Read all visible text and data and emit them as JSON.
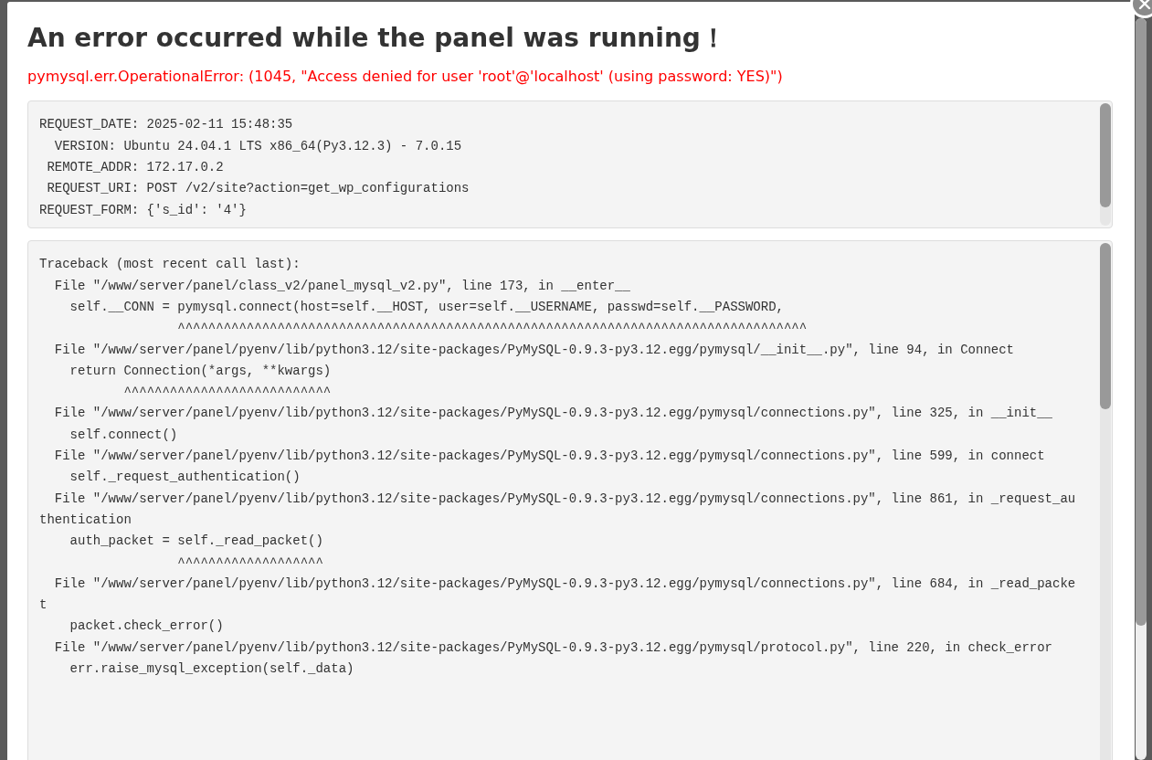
{
  "dialog": {
    "title": "An error occurred while the panel was running！",
    "error": "pymysql.err.OperationalError: (1045, \"Access denied for user 'root'@'localhost' (using password: YES)\")",
    "request_info": [
      "REQUEST_DATE: 2025-02-11 15:48:35",
      "  VERSION: Ubuntu 24.04.1 LTS x86_64(Py3.12.3) - 7.0.15",
      " REMOTE_ADDR: 172.17.0.2",
      " REQUEST_URI: POST /v2/site?action=get_wp_configurations",
      "REQUEST_FORM: {'s_id': '4'}"
    ],
    "traceback": [
      "Traceback (most recent call last):",
      "  File \"/www/server/panel/class_v2/panel_mysql_v2.py\", line 173, in __enter__",
      "    self.__CONN = pymysql.connect(host=self.__HOST, user=self.__USERNAME, passwd=self.__PASSWORD,",
      "                  ^^^^^^^^^^^^^^^^^^^^^^^^^^^^^^^^^^^^^^^^^^^^^^^^^^^^^^^^^^^^^^^^^^^^^^^^^^^^^^^^^^",
      "  File \"/www/server/panel/pyenv/lib/python3.12/site-packages/PyMySQL-0.9.3-py3.12.egg/pymysql/__init__.py\", line 94, in Connect",
      "    return Connection(*args, **kwargs)",
      "           ^^^^^^^^^^^^^^^^^^^^^^^^^^^",
      "  File \"/www/server/panel/pyenv/lib/python3.12/site-packages/PyMySQL-0.9.3-py3.12.egg/pymysql/connections.py\", line 325, in __init__",
      "    self.connect()",
      "  File \"/www/server/panel/pyenv/lib/python3.12/site-packages/PyMySQL-0.9.3-py3.12.egg/pymysql/connections.py\", line 599, in connect",
      "    self._request_authentication()",
      "  File \"/www/server/panel/pyenv/lib/python3.12/site-packages/PyMySQL-0.9.3-py3.12.egg/pymysql/connections.py\", line 861, in _request_authentication",
      "    auth_packet = self._read_packet()",
      "                  ^^^^^^^^^^^^^^^^^^^",
      "  File \"/www/server/panel/pyenv/lib/python3.12/site-packages/PyMySQL-0.9.3-py3.12.egg/pymysql/connections.py\", line 684, in _read_packet",
      "    packet.check_error()",
      "  File \"/www/server/panel/pyenv/lib/python3.12/site-packages/PyMySQL-0.9.3-py3.12.egg/pymysql/protocol.py\", line 220, in check_error",
      "    err.raise_mysql_exception(self._data)"
    ]
  }
}
